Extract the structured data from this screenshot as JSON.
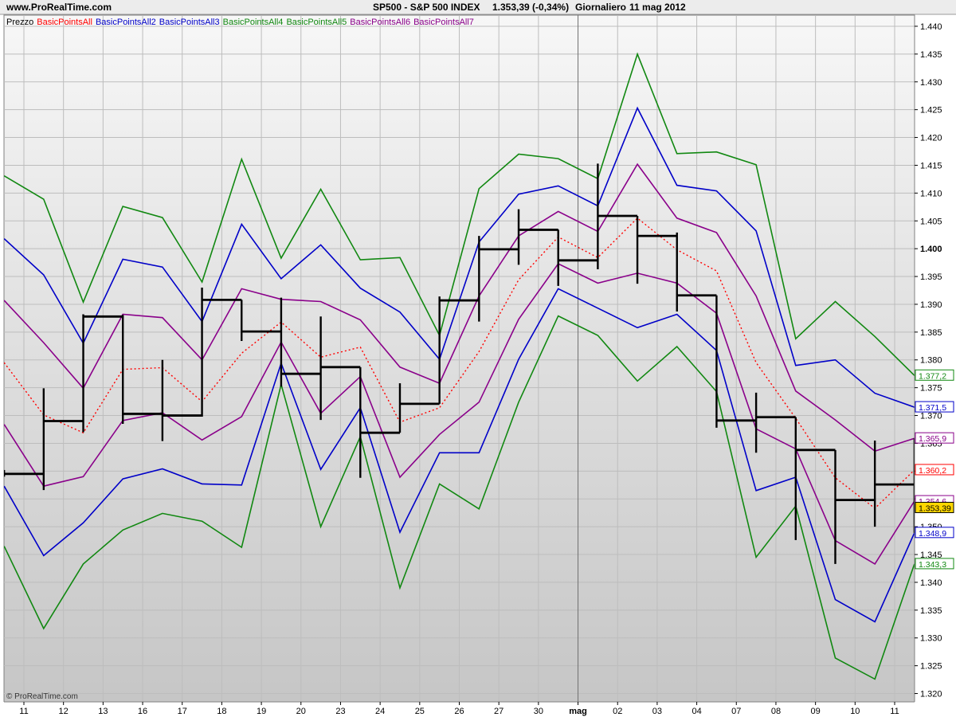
{
  "header": {
    "site": "www.ProRealTime.com",
    "symbol": "SP500 - S&P 500 INDEX",
    "quote": "1.353,39 (-0,34%)",
    "period": "Giornaliero",
    "date": "11 mag 2012"
  },
  "watermark": "© ProRealTime.com",
  "legend": [
    {
      "label": "Prezzo",
      "color": "#000000"
    },
    {
      "label": "BasicPointsAll",
      "color": "#ff0000"
    },
    {
      "label": "BasicPointsAll2",
      "color": "#0000c8"
    },
    {
      "label": "BasicPointsAll3",
      "color": "#0000c8"
    },
    {
      "label": "BasicPointsAll4",
      "color": "#118811"
    },
    {
      "label": "BasicPointsAll5",
      "color": "#118811"
    },
    {
      "label": "BasicPointsAll6",
      "color": "#8a008a"
    },
    {
      "label": "BasicPointsAll7",
      "color": "#8a008a"
    }
  ],
  "colors": {
    "price": "#000000",
    "pivot": "#ff0000",
    "blue": "#0000c8",
    "green": "#118811",
    "purple": "#8a008a",
    "current_price_bg": "#ffd700"
  },
  "chart_data": {
    "type": "line",
    "title": "SP500 - S&P 500 INDEX",
    "x_ticks": [
      "11",
      "12",
      "13",
      "16",
      "17",
      "18",
      "19",
      "20",
      "23",
      "24",
      "25",
      "26",
      "27",
      "30",
      "mag",
      "02",
      "03",
      "04",
      "07",
      "08",
      "09",
      "10",
      "11"
    ],
    "month_label": "mag",
    "y_ticks": [
      1320,
      1325,
      1330,
      1335,
      1340,
      1345,
      1350,
      1355,
      1360,
      1365,
      1370,
      1375,
      1380,
      1385,
      1390,
      1395,
      1400,
      1405,
      1410,
      1415,
      1420,
      1425,
      1430,
      1435,
      1440
    ],
    "y_tick_labels": [
      "1.320",
      "1.325",
      "1.330",
      "1.335",
      "1.340",
      "1.345",
      "1.350",
      "1.355",
      "1.360",
      "1.365",
      "1.370",
      "1.375",
      "1.380",
      "1.385",
      "1.390",
      "1.395",
      "1.400",
      "1.405",
      "1.410",
      "1.415",
      "1.420",
      "1.425",
      "1.430",
      "1.435",
      "1.440"
    ],
    "ylim": [
      1318.5,
      1442
    ],
    "grid": true,
    "ohlc": [
      {
        "o": 1359.5,
        "h": 1360.2,
        "l": 1359.0,
        "c": 1359.5
      },
      {
        "o": 1359.0,
        "h": 1374.9,
        "l": 1356.6,
        "c": 1369.0
      },
      {
        "o": 1369.0,
        "h": 1388.2,
        "l": 1367.0,
        "c": 1387.8
      },
      {
        "o": 1387.8,
        "h": 1388.1,
        "l": 1368.5,
        "c": 1370.3
      },
      {
        "o": 1370.3,
        "h": 1380.0,
        "l": 1365.4,
        "c": 1370.0
      },
      {
        "o": 1370.0,
        "h": 1393.0,
        "l": 1369.8,
        "c": 1390.8
      },
      {
        "o": 1390.8,
        "h": 1390.8,
        "l": 1383.4,
        "c": 1385.1
      },
      {
        "o": 1385.1,
        "h": 1391.2,
        "l": 1375.2,
        "c": 1377.5
      },
      {
        "o": 1377.5,
        "h": 1387.8,
        "l": 1369.2,
        "c": 1378.7
      },
      {
        "o": 1378.7,
        "h": 1378.7,
        "l": 1358.8,
        "c": 1366.9
      },
      {
        "o": 1366.9,
        "h": 1375.8,
        "l": 1366.9,
        "c": 1372.1
      },
      {
        "o": 1372.1,
        "h": 1391.4,
        "l": 1372.1,
        "c": 1390.7
      },
      {
        "o": 1390.7,
        "h": 1402.3,
        "l": 1386.9,
        "c": 1399.9
      },
      {
        "o": 1399.9,
        "h": 1407.1,
        "l": 1397.1,
        "c": 1403.4
      },
      {
        "o": 1403.4,
        "h": 1403.4,
        "l": 1393.3,
        "c": 1397.9
      },
      {
        "o": 1397.9,
        "h": 1415.3,
        "l": 1396.3,
        "c": 1405.9
      },
      {
        "o": 1405.9,
        "h": 1405.9,
        "l": 1393.7,
        "c": 1402.3
      },
      {
        "o": 1402.3,
        "h": 1402.9,
        "l": 1388.7,
        "c": 1391.6
      },
      {
        "o": 1391.6,
        "h": 1391.6,
        "l": 1367.8,
        "c": 1369.1
      },
      {
        "o": 1369.1,
        "h": 1374.1,
        "l": 1363.3,
        "c": 1369.7
      },
      {
        "o": 1369.7,
        "h": 1369.7,
        "l": 1347.6,
        "c": 1363.8
      },
      {
        "o": 1363.8,
        "h": 1363.8,
        "l": 1343.3,
        "c": 1354.8
      },
      {
        "o": 1354.8,
        "h": 1365.5,
        "l": 1350.0,
        "c": 1357.6
      },
      {
        "o": 1357.6,
        "h": 1365.9,
        "l": 1348.9,
        "c": 1353.4
      }
    ],
    "series": [
      {
        "name": "BasicPointsAll",
        "color": "#ff0000",
        "dashed": true,
        "values": [
          1379.5,
          1370.1,
          1366.9,
          1378.3,
          1378.6,
          1372.5,
          1381.2,
          1386.8,
          1380.5,
          1382.3,
          1368.8,
          1371.4,
          1381.5,
          1394.4,
          1402.1,
          1398.4,
          1405.5,
          1399.8,
          1396.0,
          1379.5,
          1369.5,
          1358.8,
          1353.3,
          1360.2
        ]
      },
      {
        "name": "BasicPointsAll2",
        "color": "#0000c8",
        "values": [
          1401.8,
          1395.3,
          1383.0,
          1398.1,
          1396.7,
          1386.9,
          1404.4,
          1394.6,
          1400.7,
          1392.9,
          1388.6,
          1380.1,
          1401.2,
          1409.8,
          1411.3,
          1407.7,
          1425.3,
          1411.4,
          1410.4,
          1403.2,
          1379.0,
          1380.0,
          1374.0,
          1371.5
        ]
      },
      {
        "name": "BasicPointsAll3",
        "color": "#0000c8",
        "values": [
          1357.3,
          1344.8,
          1350.7,
          1358.6,
          1360.4,
          1357.7,
          1357.5,
          1379.4,
          1360.3,
          1371.4,
          1349.0,
          1363.3,
          1363.3,
          1380.1,
          1392.8,
          1389.3,
          1385.8,
          1388.2,
          1381.7,
          1356.5,
          1358.9,
          1336.9,
          1332.9,
          1348.9
        ]
      },
      {
        "name": "BasicPointsAll4",
        "color": "#118811",
        "values": [
          1413.1,
          1408.9,
          1390.4,
          1407.6,
          1405.6,
          1394.0,
          1416.1,
          1398.3,
          1410.7,
          1398.0,
          1398.4,
          1384.4,
          1410.8,
          1417.0,
          1416.2,
          1412.6,
          1435.0,
          1417.1,
          1417.4,
          1415.1,
          1383.8,
          1390.5,
          1384.2,
          1377.2
        ]
      },
      {
        "name": "BasicPointsAll5",
        "color": "#118811",
        "values": [
          1346.5,
          1331.7,
          1343.3,
          1349.4,
          1352.4,
          1351.0,
          1346.3,
          1375.6,
          1350.0,
          1366.2,
          1339.0,
          1357.7,
          1353.2,
          1372.4,
          1387.9,
          1384.4,
          1376.2,
          1382.4,
          1374.3,
          1344.5,
          1353.7,
          1326.4,
          1322.6,
          1343.3
        ]
      },
      {
        "name": "BasicPointsAll6",
        "color": "#8a008a",
        "values": [
          1390.7,
          1383.1,
          1374.9,
          1388.2,
          1387.6,
          1380.0,
          1392.8,
          1390.9,
          1390.5,
          1387.2,
          1378.7,
          1375.8,
          1391.5,
          1402.3,
          1406.7,
          1403.1,
          1415.2,
          1405.5,
          1402.9,
          1391.5,
          1374.4,
          1369.2,
          1363.6,
          1365.9
        ]
      },
      {
        "name": "BasicPointsAll7",
        "color": "#8a008a",
        "values": [
          1368.4,
          1357.3,
          1359.0,
          1369.1,
          1370.5,
          1365.6,
          1369.8,
          1383.2,
          1370.4,
          1377.0,
          1358.9,
          1366.6,
          1372.4,
          1387.3,
          1397.3,
          1393.8,
          1395.6,
          1393.8,
          1388.4,
          1367.6,
          1364.0,
          1347.5,
          1343.3,
          1354.6
        ]
      }
    ],
    "price_labels": [
      {
        "text": "1.377,2",
        "value": 1377.2,
        "color": "#118811"
      },
      {
        "text": "1.371,5",
        "value": 1371.5,
        "color": "#0000c8"
      },
      {
        "text": "1.365,9",
        "value": 1365.9,
        "color": "#8a008a"
      },
      {
        "text": "1.360,2",
        "value": 1360.2,
        "color": "#ff0000"
      },
      {
        "text": "1.354,6",
        "value": 1354.6,
        "color": "#8a008a"
      },
      {
        "text": "1.353,39",
        "value": 1353.39,
        "color": "#000000",
        "highlight": true
      },
      {
        "text": "1.348,9",
        "value": 1348.9,
        "color": "#0000c8"
      },
      {
        "text": "1.343,3",
        "value": 1343.3,
        "color": "#118811"
      }
    ]
  }
}
